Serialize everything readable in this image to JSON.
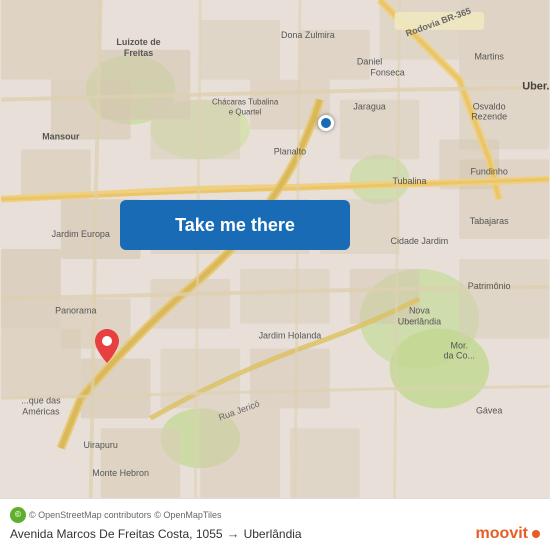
{
  "map": {
    "background_color": "#e8e0d8",
    "button_label": "Take me there",
    "button_color": "#1a6bb5"
  },
  "bottom_bar": {
    "origin": "Avenida Marcos De Freitas Costa, 1055",
    "destination": "Uberlândia",
    "arrow": "→",
    "attribution_osm": "© OpenStreetMap contributors",
    "attribution_tiles": "© OpenMapTiles",
    "brand": "moovit"
  },
  "icons": {
    "pin": "📍",
    "arrow": "→",
    "osm": "©"
  }
}
